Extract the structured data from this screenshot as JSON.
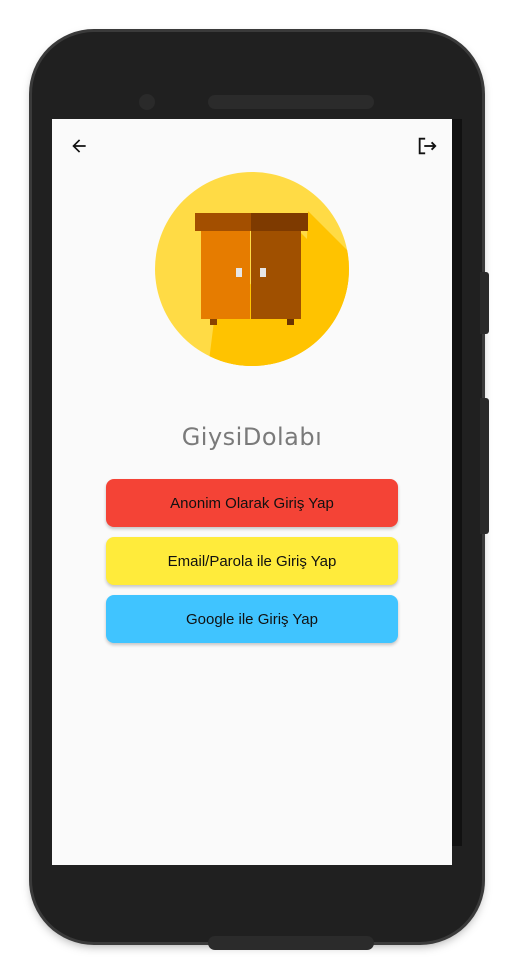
{
  "app": {
    "title": "GiysiDolabı"
  },
  "appbar": {
    "back_icon": "arrow-left-icon",
    "logout_icon": "logout-icon"
  },
  "logo": {
    "icon": "wardrobe-icon",
    "circle_color": "#FFD93B",
    "shadow_color": "#FFC300"
  },
  "buttons": [
    {
      "label": "Anonim Olarak Giriş Yap",
      "color": "#F44336"
    },
    {
      "label": "Email/Parola ile Giriş Yap",
      "color": "#FFEB3B"
    },
    {
      "label": "Google ile Giriş Yap",
      "color": "#40C4FF"
    }
  ]
}
